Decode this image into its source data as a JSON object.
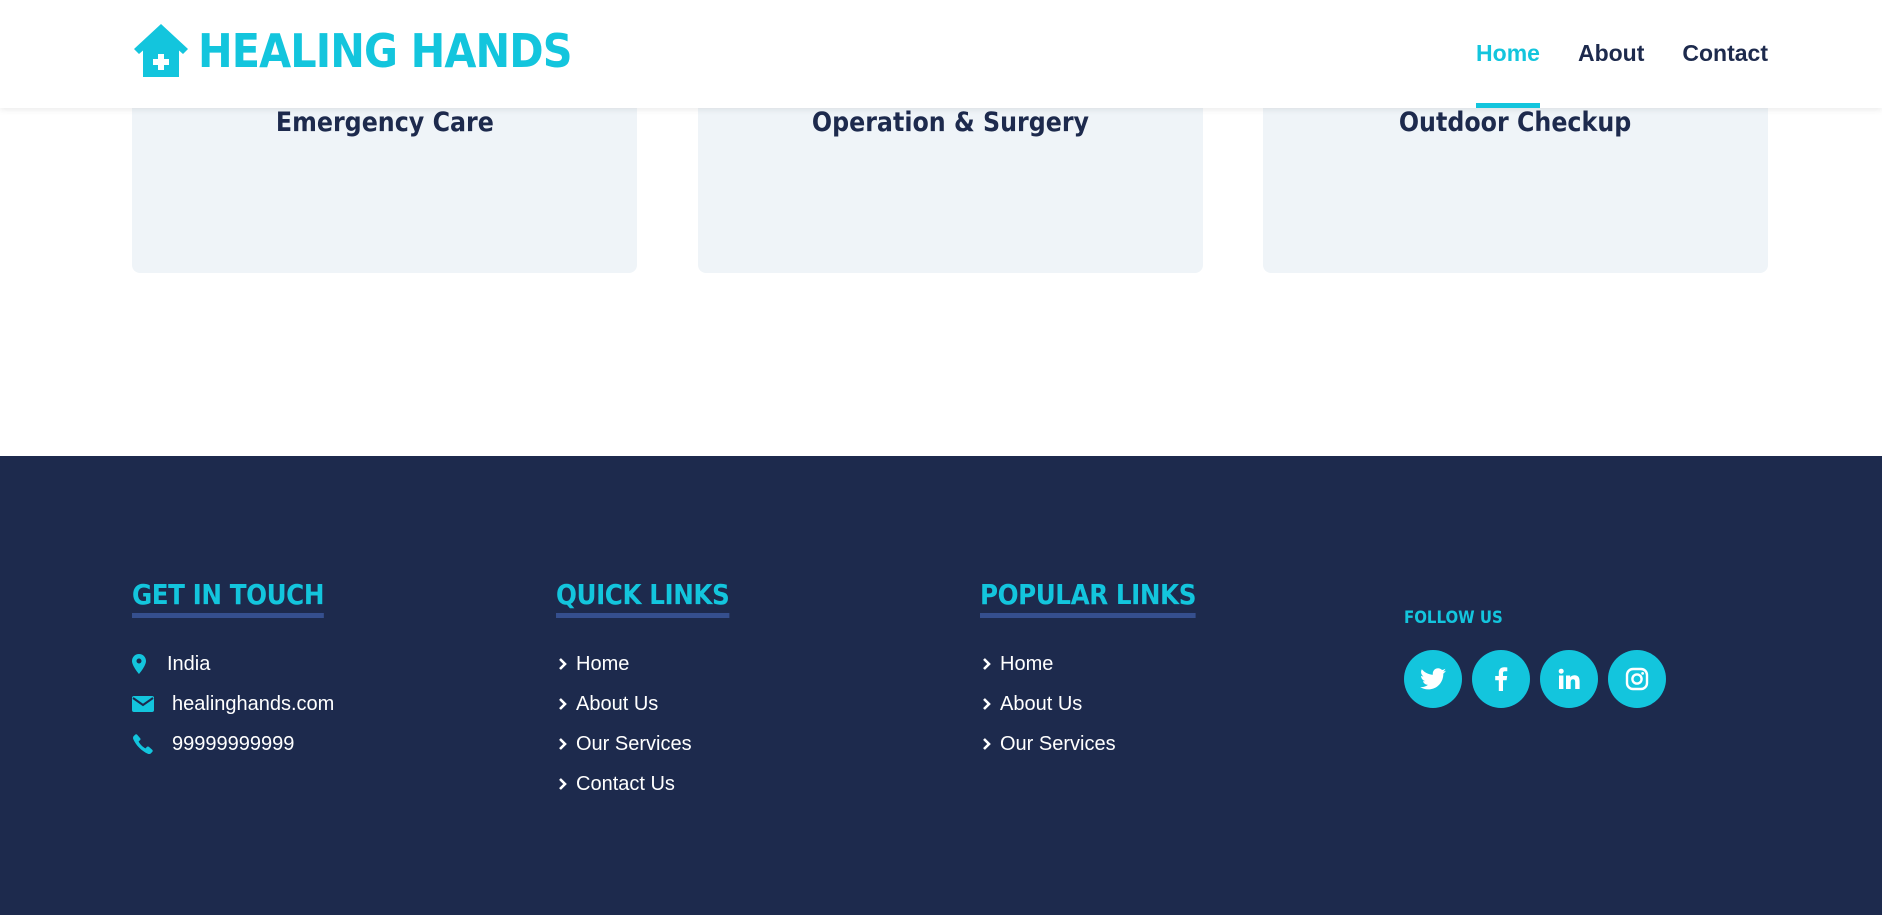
{
  "brand": {
    "name": "HEALING HANDS",
    "icon": "house-medical-icon"
  },
  "nav": {
    "items": [
      {
        "label": "Home",
        "active": true
      },
      {
        "label": "About",
        "active": false
      },
      {
        "label": "Contact",
        "active": false
      }
    ]
  },
  "services": {
    "cards": [
      {
        "title": "Emergency Care"
      },
      {
        "title": "Operation & Surgery"
      },
      {
        "title": "Outdoor Checkup"
      }
    ]
  },
  "footer": {
    "get_in_touch": {
      "title": "GET IN TOUCH",
      "items": [
        {
          "icon": "map-marker-icon",
          "text": "India"
        },
        {
          "icon": "envelope-icon",
          "text": "healinghands.com"
        },
        {
          "icon": "phone-icon",
          "text": "99999999999"
        }
      ]
    },
    "quick_links": {
      "title": "QUICK LINKS",
      "items": [
        "Home",
        "About Us",
        "Our Services",
        "Contact Us"
      ]
    },
    "popular_links": {
      "title": "POPULAR LINKS",
      "items": [
        "Home",
        "About Us",
        "Our Services"
      ]
    },
    "follow_us": {
      "title": "FOLLOW US",
      "socials": [
        "twitter-icon",
        "facebook-icon",
        "linkedin-icon",
        "instagram-icon"
      ]
    }
  },
  "colors": {
    "accent": "#13c5dd",
    "navy": "#1d2a4d",
    "card_bg": "#eff4f8",
    "underline": "#354f8e"
  }
}
